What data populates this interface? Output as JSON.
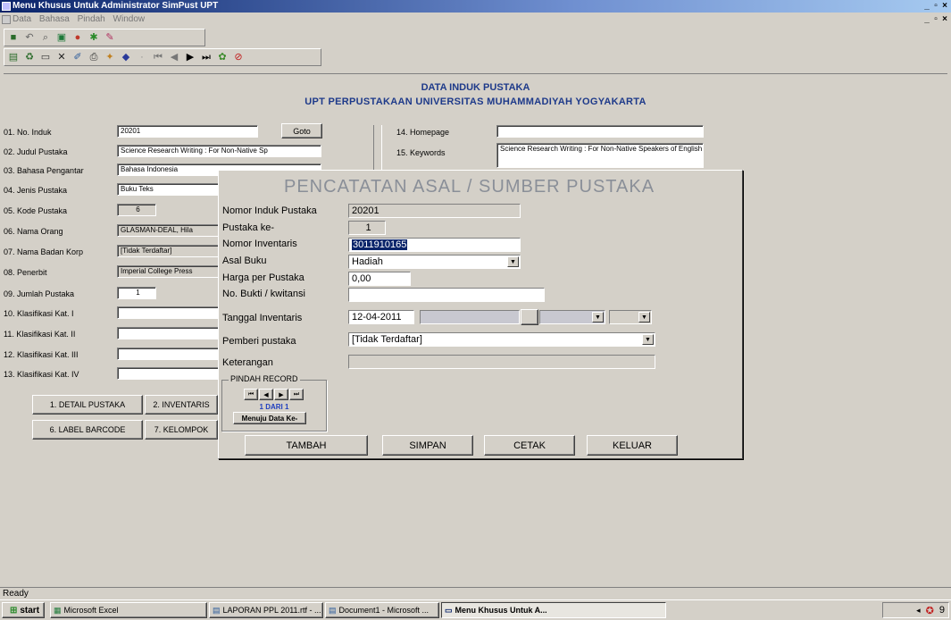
{
  "window": {
    "title": "Menu Khusus Untuk Administrator SimPust UPT",
    "controls": [
      "_",
      "▫",
      "×"
    ]
  },
  "menu": [
    "Data",
    "Bahasa",
    "Pindah",
    "Window"
  ],
  "header": {
    "line1": "DATA  INDUK PUSTAKA",
    "line2": "UPT PERPUSTAKAAN UNIVERSITAS MUHAMMADIYAH YOGYAKARTA"
  },
  "form": {
    "fields": [
      {
        "label": "01. No. Induk",
        "value": "20201"
      },
      {
        "label": "02. Judul Pustaka",
        "value": "Science Research Writing : For Non-Native Sp"
      },
      {
        "label": "03. Bahasa Pengantar",
        "value": "Bahasa Indonesia"
      },
      {
        "label": "04. Jenis Pustaka",
        "value": "Buku Teks"
      },
      {
        "label": "05. Kode Pustaka",
        "value": "6"
      },
      {
        "label": "06. Nama Orang",
        "value": "GLASMAN-DEAL, Hila"
      },
      {
        "label": "07. Nama Badan Korp",
        "value": "[Tidak Terdaftar]"
      },
      {
        "label": "08. Penerbit",
        "value": "Imperial College Press"
      },
      {
        "label": "09. Jumlah Pustaka",
        "value": "1"
      },
      {
        "label": "10. Klasifikasi Kat. I",
        "value": ""
      },
      {
        "label": "11. Klasifikasi Kat. II",
        "value": ""
      },
      {
        "label": "12. Klasifikasi Kat. III",
        "value": ""
      },
      {
        "label": "13. Klasifikasi Kat. IV",
        "value": ""
      }
    ],
    "goto_label": "Goto",
    "right": {
      "homepage_label": "14. Homepage",
      "homepage_value": "",
      "keywords_label": "15. Keywords",
      "keywords_value": "Science Research Writing : For Non-Native Speakers of English"
    },
    "buttons": [
      "1. DETAIL PUSTAKA",
      "2. INVENTARIS",
      "6. LABEL BARCODE",
      "7. KELOMPOK"
    ]
  },
  "dialog": {
    "title": "PENCATATAN ASAL / SUMBER PUSTAKA",
    "nomor_induk_label": "Nomor Induk Pustaka",
    "nomor_induk_value": "20201",
    "pustaka_ke_label": "Pustaka ke-",
    "pustaka_ke_value": "1",
    "nomor_inventaris_label": "Nomor Inventaris",
    "nomor_inventaris_value": "3011910165",
    "asal_buku_label": "Asal Buku",
    "asal_buku_value": "Hadiah",
    "harga_label": "Harga per Pustaka",
    "harga_value": "0,00",
    "bukti_label": "No. Bukti / kwitansi",
    "bukti_value": "",
    "tanggal_label": "Tanggal Inventaris",
    "tanggal_value": "12-04-2011",
    "pemberi_label": "Pemberi pustaka",
    "pemberi_value": "[Tidak Terdaftar]",
    "keterangan_label": "Keterangan",
    "keterangan_value": "",
    "pindah_record": {
      "label": "PINDAH RECORD",
      "status": "1 DARI 1",
      "goto_button": "Menuju Data Ke-"
    },
    "buttons": {
      "tambah": "TAMBAH",
      "simpan": "SIMPAN",
      "cetak": "CETAK",
      "keluar": "KELUAR"
    }
  },
  "status": {
    "text": "Ready"
  },
  "taskbar": {
    "start": "start",
    "items": [
      {
        "label": "Microsoft Excel",
        "active": false
      },
      {
        "label": "LAPORAN PPL 2011.rtf - ...",
        "active": false
      },
      {
        "label": "Document1 - Microsoft ...",
        "active": false
      },
      {
        "label": "Menu Khusus Untuk A...",
        "active": true
      }
    ],
    "clock": "9"
  },
  "colors": {
    "title_gradient_start": "#0a246a",
    "header_text": "#1e3a8a",
    "dialog_title": "#8a8f98",
    "selection": "#0a246a",
    "record_status": "#1f3fbf"
  }
}
